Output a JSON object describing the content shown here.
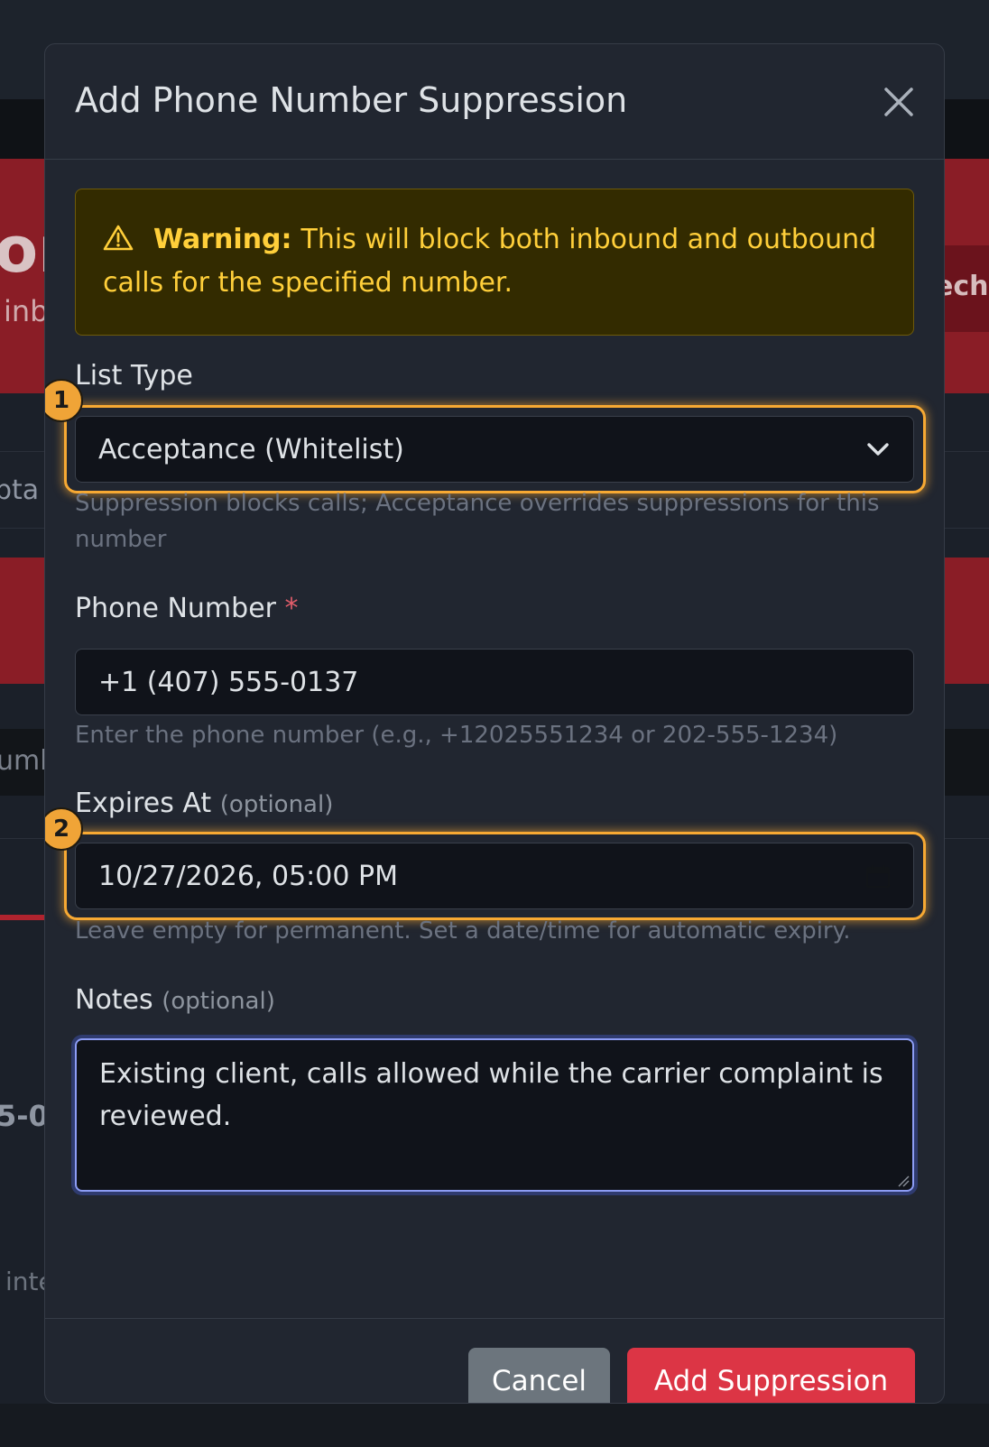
{
  "modal": {
    "title": "Add Phone Number Suppression",
    "close_icon": "close-icon"
  },
  "warning": {
    "icon": "warning-triangle-icon",
    "strong": "Warning:",
    "text": "This will block both inbound and outbound calls for the specified number.",
    "color": "#ffcf3a"
  },
  "list_type": {
    "label": "List Type",
    "badge": "1",
    "value": "Acceptance (Whitelist)",
    "icon": "chevron-down-icon",
    "help": "Suppression blocks calls; Acceptance overrides suppressions for this number"
  },
  "phone": {
    "label": "Phone Number",
    "required": "*",
    "value": "+1 (407) 555-0137",
    "help": "Enter the phone number (e.g., +12025551234 or 202-555-1234)"
  },
  "expires": {
    "label": "Expires At",
    "optional": "(optional)",
    "badge": "2",
    "value": "10/27/2026, 05:00 PM",
    "icon": "calendar-icon",
    "help": "Leave empty for permanent. Set a date/time for automatic expiry."
  },
  "notes": {
    "label": "Notes",
    "optional": "(optional)",
    "value": "Existing client, calls allowed while the carrier complaint is reviewed."
  },
  "footer": {
    "cancel_label": "Cancel",
    "submit_label": "Add Suppression",
    "submit_color": "#dc3545"
  },
  "background": {
    "hero_text": "on",
    "hero_sub": "inb",
    "hero_button": "ech",
    "row_text_1": "pta",
    "row_text_2": "umb",
    "row_number": "5-0",
    "row_text_3": "inte"
  }
}
